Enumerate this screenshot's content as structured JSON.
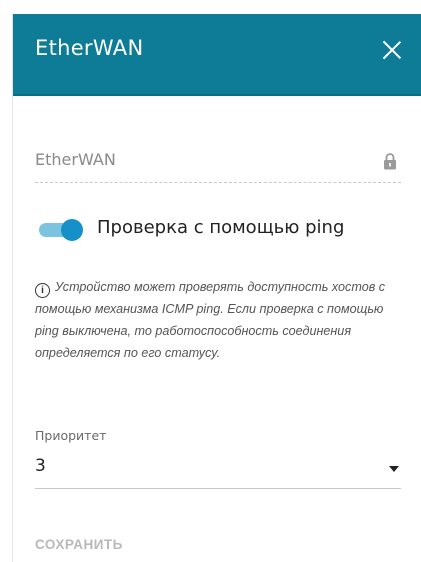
{
  "dialog": {
    "title": "EtherWAN",
    "close_icon": "close-icon"
  },
  "name_field": {
    "value": "EtherWAN",
    "lock_icon": "lock-icon"
  },
  "ping_toggle": {
    "label": "Проверка с помощью ping",
    "enabled": true
  },
  "info": {
    "icon": "info-icon",
    "text": "Устройство может проверять доступность хостов с помощью механизма ICMP ping. Если проверка с помощью ping выключена, то работоспособность соединения определяется по его статусу."
  },
  "priority": {
    "label": "Приоритет",
    "value": "3"
  },
  "actions": {
    "save_label": "СОХРАНИТЬ"
  },
  "colors": {
    "header_bg": "#0f7c97",
    "toggle_track": "#7cc3df",
    "toggle_knob": "#1690c8",
    "save_disabled": "#b9b9b9"
  }
}
